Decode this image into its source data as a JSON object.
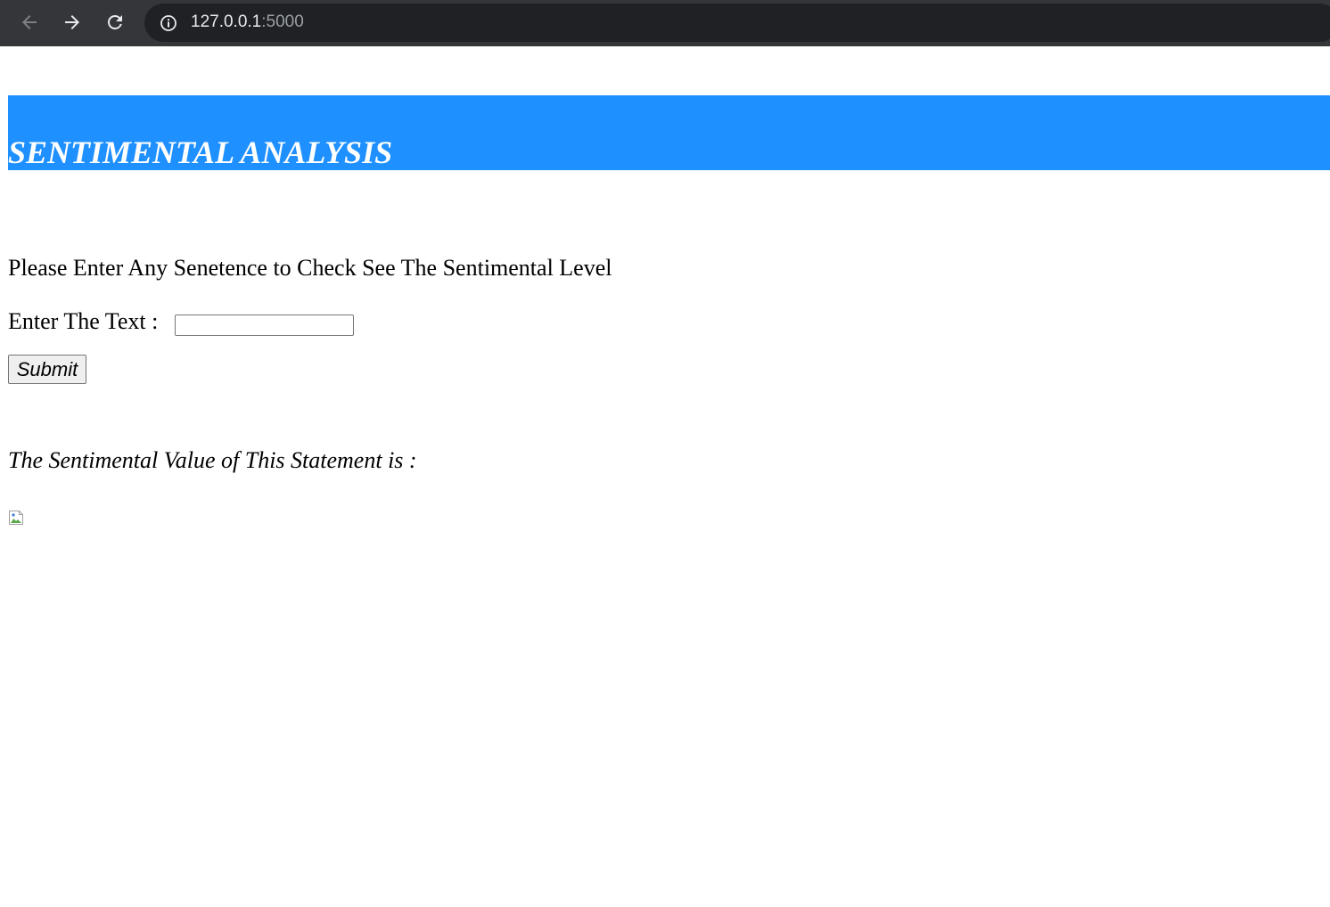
{
  "browser": {
    "url_host": "127.0.0.1",
    "url_port": ":5000",
    "icons": {
      "back": "arrow-left-icon",
      "forward": "arrow-right-icon",
      "reload": "reload-icon",
      "site_info": "info-icon"
    }
  },
  "header": {
    "title": "SENTIMENTAL ANALYSIS",
    "background_color": "#1e90ff",
    "text_color": "#ffffff"
  },
  "main": {
    "instruction": "Please Enter Any Senetence to Check See The Sentimental Level",
    "input_label": "Enter The Text :",
    "input_value": "",
    "submit_label": "Submit",
    "result_label": "The Sentimental Value of This Statement is :",
    "result_image_icon": "broken-image-icon"
  }
}
